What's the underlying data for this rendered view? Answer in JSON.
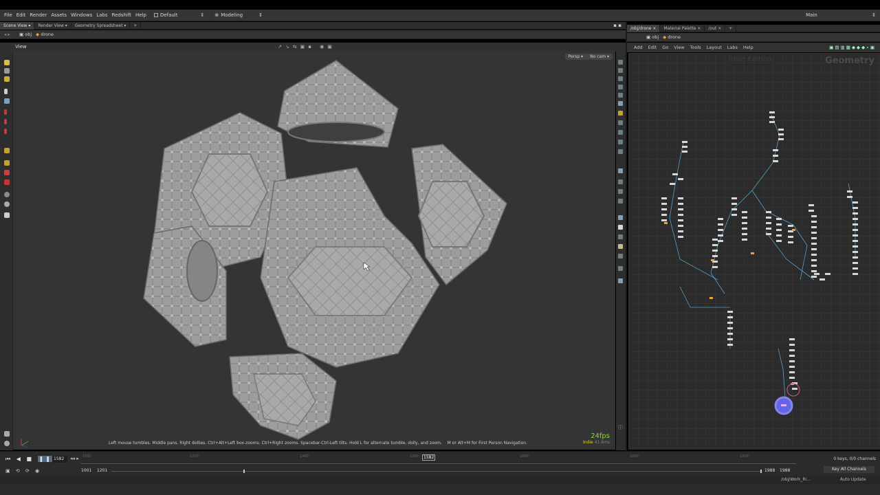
{
  "menubar": {
    "items": [
      "File",
      "Edit",
      "Render",
      "Assets",
      "Windows",
      "Labs",
      "Redshift",
      "Help"
    ],
    "desktop": "Default",
    "shelf": "Modeling",
    "main": "Main"
  },
  "left_pane": {
    "tabs": [
      "Scene View",
      "Render View",
      "Geometry Spreadsheet"
    ],
    "path": [
      "obj",
      "drone"
    ],
    "view_label": "View",
    "persp": "Persp",
    "cam": "No cam",
    "help_text": "Left mouse tumbles. Middle pans. Right dollies. Ctrl+Alt+Left box-zooms. Ctrl+Right zooms. Spacebar-Ctrl-Left tilts. Hold L for alternate tumble, dolly, and zoom.",
    "help_text2": "M or Alt+M for First Person Navigation.",
    "fps": "24fps",
    "fps_sub": "Indie",
    "fps_ms": "41.6ms"
  },
  "right_pane": {
    "tabs": [
      "/obj/drone",
      "Material Palette",
      "/out"
    ],
    "path": [
      "obj",
      "drone"
    ],
    "menu": [
      "Add",
      "Edit",
      "Go",
      "View",
      "Tools",
      "Layout",
      "Labs",
      "Help"
    ],
    "watermark": "Indie Edition",
    "context": "Geometry"
  },
  "timeline": {
    "frame": "1582",
    "ticks": [
      "1201",
      "1320",
      "1440",
      "1560",
      "1680",
      "1800",
      "1920"
    ],
    "current_marker": "1582",
    "start": "1001",
    "range_start": "1201",
    "range_end": "1988",
    "end": "1988",
    "keys_label": "0 keys, 0/0 channels",
    "key_all": "Key All Channels",
    "status_path": "/obj/Work_Ri...",
    "auto_update": "Auto Update"
  },
  "colors": {
    "accent_green": "#8fd14f",
    "net_node": "#d7d7d7",
    "wire": "#5aa0c8",
    "display_node": "#6b6bff"
  }
}
